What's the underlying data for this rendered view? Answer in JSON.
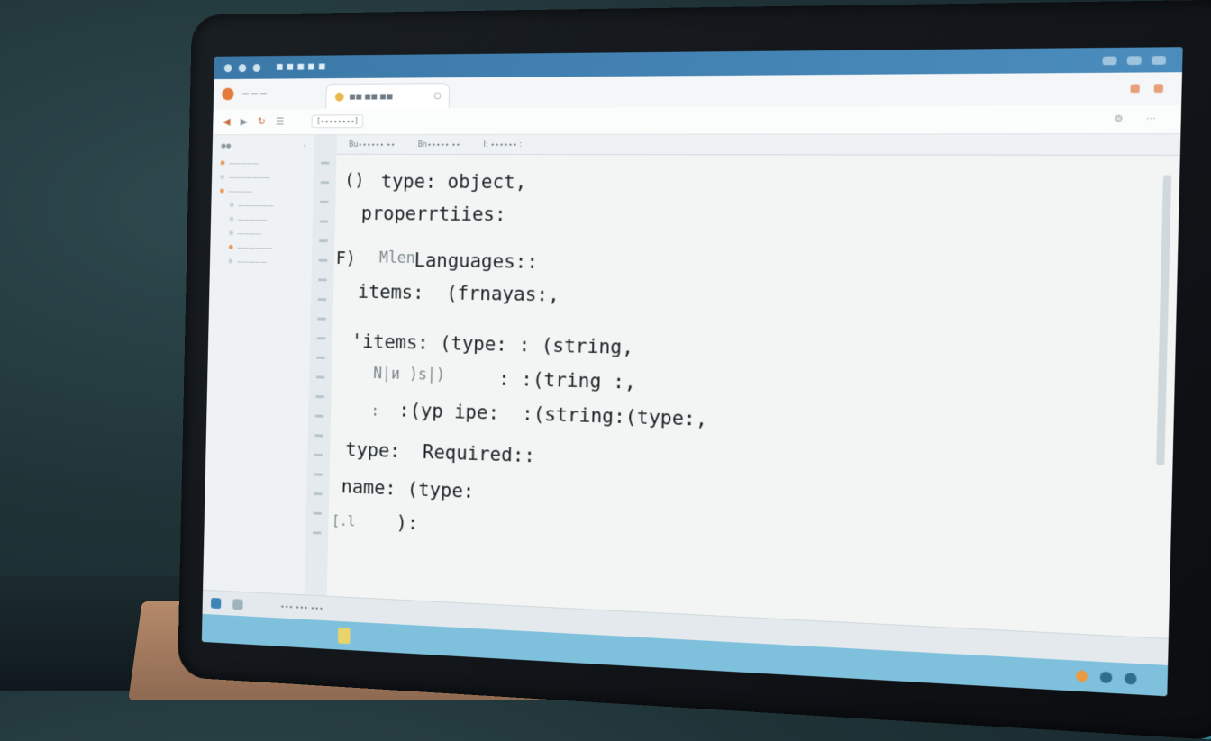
{
  "window": {
    "title": "■ ■ ■ ■ ■",
    "accent": "#3b78a8"
  },
  "tabs": {
    "home_label": "— — —",
    "active_tab_label": "■■ ■■ ■■",
    "close_glyph": "○"
  },
  "toolbar": {
    "address": "[∙∙∙∙∙∙∙∙]",
    "icons": [
      "back-icon",
      "forward-icon",
      "refresh-icon",
      "menu-icon"
    ]
  },
  "sidebar": {
    "items": [
      "—————",
      "———————",
      "————",
      "——————",
      "—————",
      "————",
      "——————",
      "—————"
    ]
  },
  "editor_tabs": [
    "Bu∙∙∙∙∙∙ ∙∙",
    "Bn∙∙∙∙∙ ∙∙",
    "I: ∙∙∙∙∙∙ :"
  ],
  "code": {
    "line1_gutter": "()",
    "line1": "type: object,",
    "line2": "properrtiies:",
    "line3_gutter": "F)",
    "line3_ghost": "Mlen",
    "line3": "Languages::",
    "line4": "items:  (frnayas:,",
    "line5": "'items: (type: : (string,",
    "line6_ghost": "N|и )s|)",
    "line6": ": :(tring :,",
    "line7_ghost": ":",
    "line7": ":(yp ipe:  :(string:(type:,",
    "line8": "type:  Required::",
    "line9": "name: (type:",
    "line10_gutter": "[.l",
    "line10": "):"
  },
  "statusbar": {
    "text": "∙∙∙ ∙∙∙ ∙∙∙"
  }
}
